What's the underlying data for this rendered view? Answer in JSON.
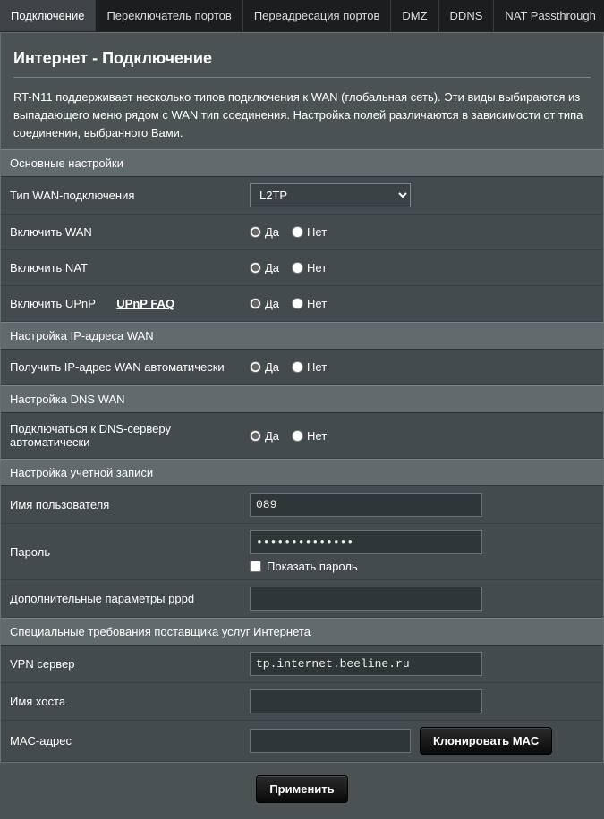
{
  "tabs": [
    {
      "label": "Подключение",
      "active": true
    },
    {
      "label": "Переключатель портов"
    },
    {
      "label": "Переадресация портов"
    },
    {
      "label": "DMZ"
    },
    {
      "label": "DDNS"
    },
    {
      "label": "NAT Passthrough"
    }
  ],
  "title": "Интернет - Подключение",
  "description": "RT-N11 поддерживает несколько типов подключения к WAN (глобальная сеть). Эти виды выбираются из выпадающего меню рядом с WAN тип соединения. Настройка полей различаются в зависимости от типа соединения, выбранного Вами.",
  "radio": {
    "yes": "Да",
    "no": "Нет"
  },
  "sections": {
    "basic": {
      "header": "Основные настройки",
      "wan_type_label": "Тип WAN-подключения",
      "wan_type_value": "L2TP",
      "enable_wan_label": "Включить WAN",
      "enable_nat_label": "Включить NAT",
      "enable_upnp_label": "Включить UPnP",
      "upnp_faq": "UPnP  FAQ"
    },
    "wan_ip": {
      "header": "Настройка IP-адреса WAN",
      "auto_ip_label": "Получить IP-адрес WAN автоматически"
    },
    "dns": {
      "header": "Настройка DNS WAN",
      "auto_dns_label": "Подключаться к DNS-серверу автоматически"
    },
    "account": {
      "header": "Настройка учетной записи",
      "user_label": "Имя пользователя",
      "user_value": "089",
      "pass_label": "Пароль",
      "pass_value": "••••••••••••••",
      "show_pass_label": "Показать пароль",
      "pppd_label": "Дополнительные параметры pppd",
      "pppd_value": ""
    },
    "isp": {
      "header": "Специальные требования поставщика услуг Интернета",
      "vpn_label": "VPN сервер",
      "vpn_value": "tp.internet.beeline.ru",
      "host_label": "Имя хоста",
      "host_value": "",
      "mac_label": "MAC-адрес",
      "mac_value": "",
      "clone_mac": "Клонировать MAC"
    }
  },
  "apply_label": "Применить"
}
